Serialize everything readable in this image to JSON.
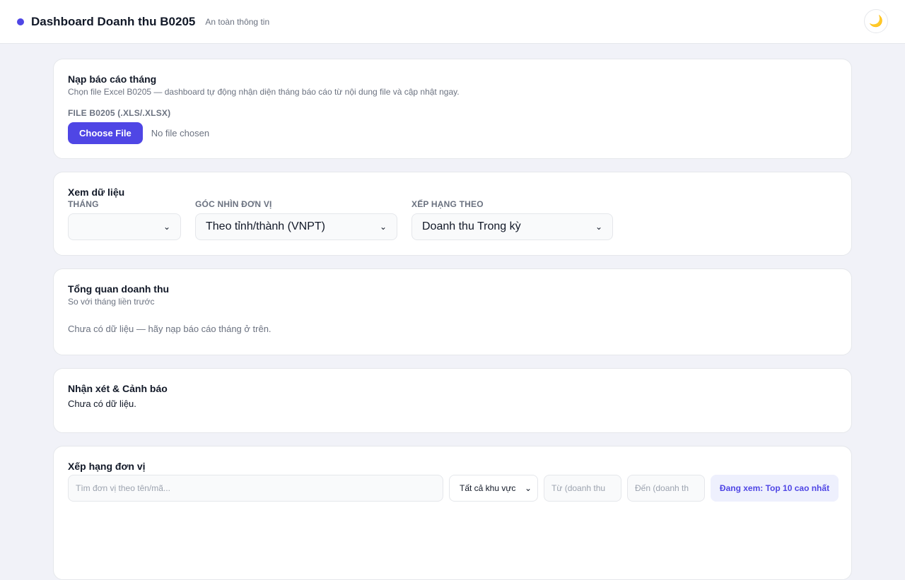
{
  "header": {
    "title": "Dashboard Doanh thu B0205",
    "subtitle": "An toàn thông tin",
    "theme_icon": "🌙"
  },
  "upload": {
    "title": "Nạp báo cáo tháng",
    "description": "Chọn file Excel B0205 — dashboard tự động nhận diện tháng báo cáo từ nội dung file và cập nhật ngay.",
    "field_label": "FILE B0205 (.XLS/.XLSX)",
    "button_label": "Choose File",
    "status": "No file chosen"
  },
  "view": {
    "title": "Xem dữ liệu",
    "month_label": "THÁNG",
    "month_value": "",
    "unit_label": "GÓC NHÌN ĐƠN VỊ",
    "unit_value": "Theo tỉnh/thành (VNPT)",
    "rank_label": "XẾP HẠNG THEO",
    "rank_value": "Doanh thu Trong kỳ"
  },
  "overview": {
    "title": "Tổng quan doanh thu",
    "subtitle": "So với tháng liền trước",
    "empty_text": "Chưa có dữ liệu — hãy nạp báo cáo tháng ở trên."
  },
  "alerts": {
    "title": "Nhận xét & Cảnh báo",
    "empty_text": "Chưa có dữ liệu."
  },
  "ranking": {
    "title": "Xếp hạng đơn vị",
    "search_placeholder": "Tìm đơn vị theo tên/mã...",
    "region_value": "Tất cả khu vực",
    "from_placeholder": "Từ (doanh thu",
    "to_placeholder": "Đến (doanh th",
    "viewing_badge": "Đang xem: Top 10 cao nhất"
  },
  "colors": {
    "accent": "#4f46e5",
    "background": "#f1f2f8",
    "card": "#ffffff"
  }
}
